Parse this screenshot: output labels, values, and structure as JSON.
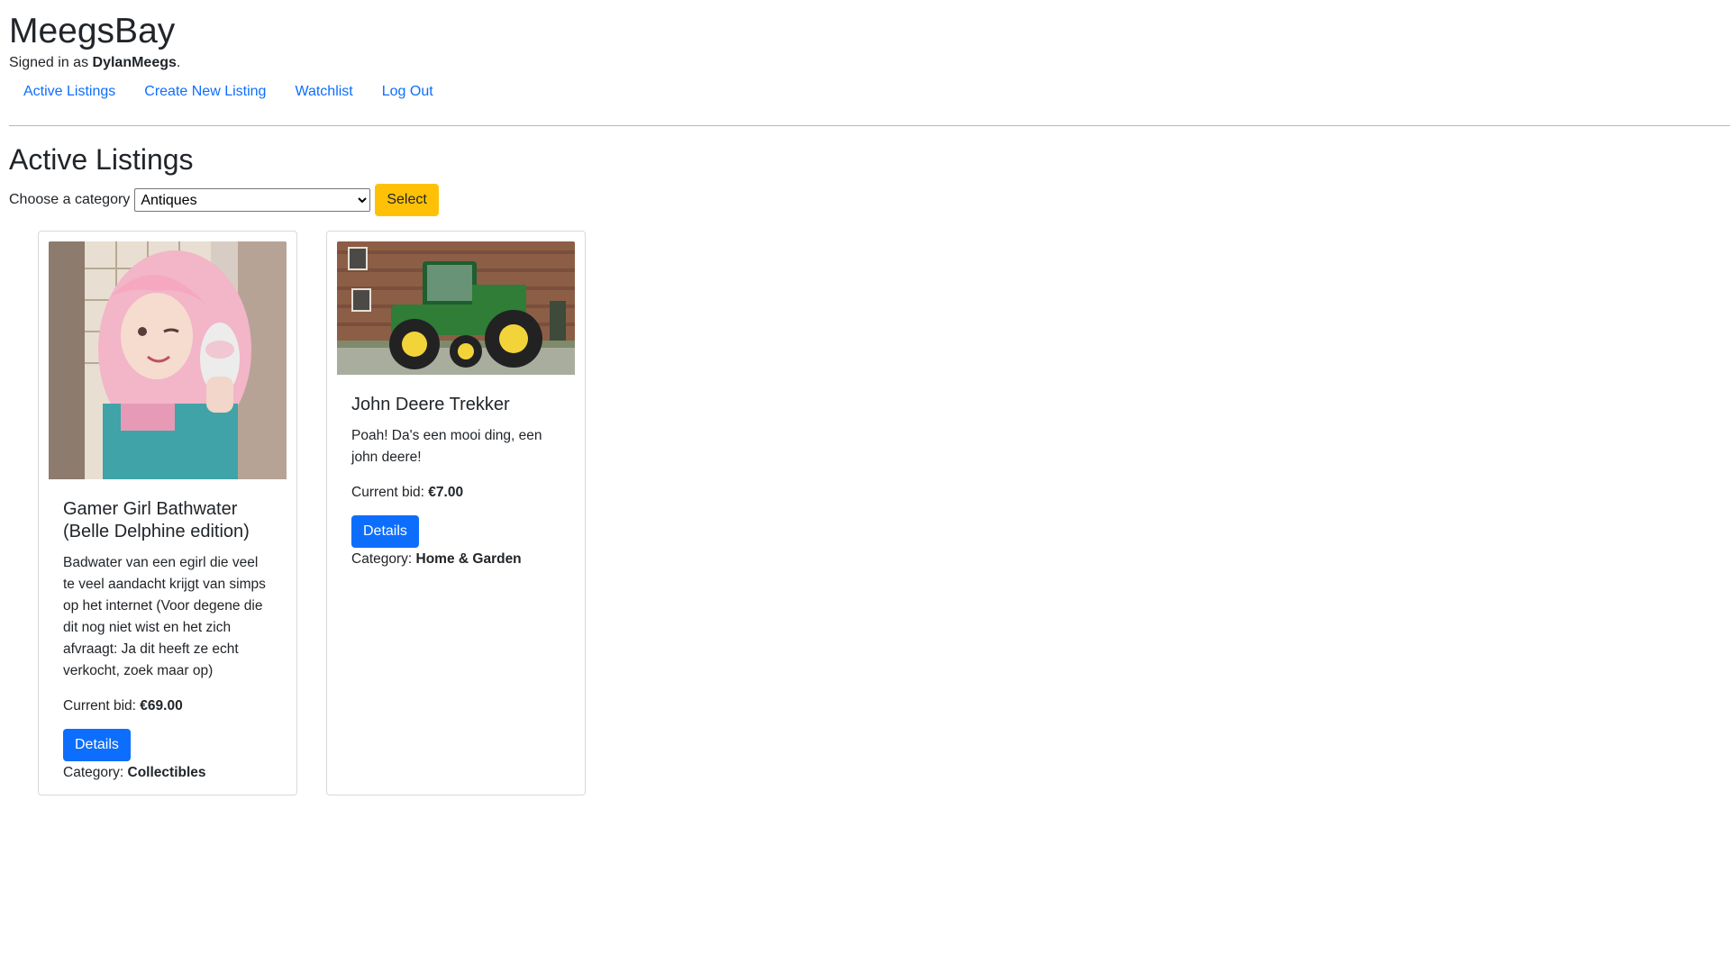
{
  "site": {
    "title": "MeegsBay"
  },
  "user": {
    "prefix": "Signed in as ",
    "name": "DylanMeegs",
    "suffix": "."
  },
  "nav": {
    "items": [
      {
        "label": "Active Listings"
      },
      {
        "label": "Create New Listing"
      },
      {
        "label": "Watchlist"
      },
      {
        "label": "Log Out"
      }
    ]
  },
  "main": {
    "heading": "Active Listings",
    "filter": {
      "label": "Choose a category",
      "selected": "Antiques",
      "button_label": "Select"
    }
  },
  "listings": [
    {
      "title": "Gamer Girl Bathwater (Belle Delphine edition)",
      "description": "Badwater van een egirl die veel te veel aandacht krijgt van simps op het internet (Voor degene die dit nog niet wist en het zich afvraagt: Ja dit heeft ze echt verkocht, zoek maar op)",
      "bid_label": "Current bid: ",
      "bid": "€69.00",
      "details_label": "Details",
      "category_label": "Category: ",
      "category": "Collectibles",
      "image_icon": "portrait-photo"
    },
    {
      "title": "John Deere Trekker",
      "description": "Poah! Da's een mooi ding, een john deere!",
      "bid_label": "Current bid: ",
      "bid": "€7.00",
      "details_label": "Details",
      "category_label": "Category: ",
      "category": "Home & Garden",
      "image_icon": "tractor-photo"
    }
  ],
  "colors": {
    "link": "#0d6efd",
    "select_button": "#ffc107",
    "details_button": "#0d6efd"
  }
}
